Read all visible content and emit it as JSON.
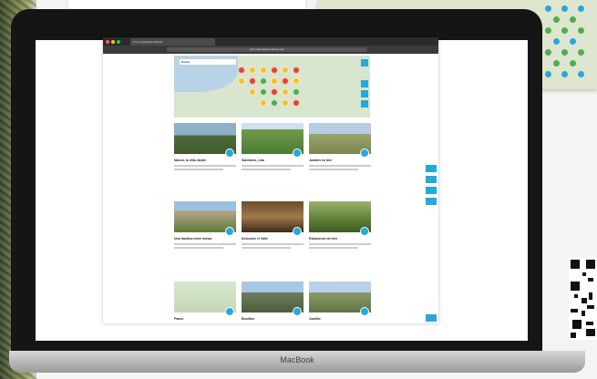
{
  "device": {
    "brand": "MacBook"
  },
  "browser": {
    "tab_title": "En la naturaleza Valonia",
    "url": "www.naturaleza-valonia.com"
  },
  "map": {
    "search_placeholder": "Buscar"
  },
  "cards": [
    {
      "title": "Namur, la villa-Jardin"
    },
    {
      "title": "Salzinnes, ruta"
    },
    {
      "title": "Jambes en bici"
    },
    {
      "title": "Una basílica entre ruinas"
    },
    {
      "title": "Descubre el Valle"
    },
    {
      "title": "Estaciones de tren"
    },
    {
      "title": "Paseo"
    },
    {
      "title": "Bouillon"
    },
    {
      "title": "Castillo"
    }
  ],
  "colors": {
    "accent": "#28a8d8",
    "cluster_red": "#e2452b",
    "cluster_yellow": "#f1c232",
    "cluster_green": "#4caf50"
  }
}
